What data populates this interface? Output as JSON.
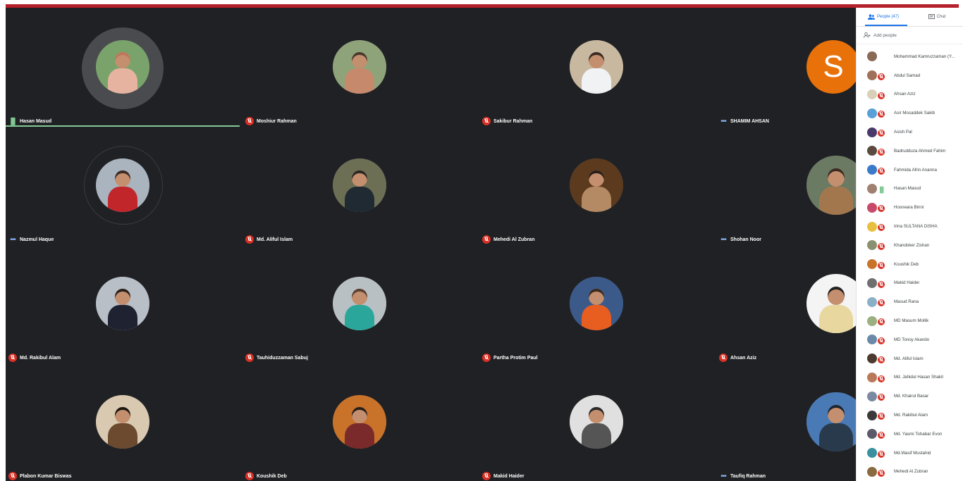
{
  "tiles": [
    {
      "name": "Hasan Masud",
      "status": "speaking",
      "photo": [
        "#7aa36b",
        "#c0765a",
        "#e6b3a0"
      ],
      "ring": "big"
    },
    {
      "name": "Moshiur Rahman",
      "status": "muted",
      "photo": [
        "#8fa37a",
        "#4a3a2e",
        "#c7896b"
      ]
    },
    {
      "name": "Sakibur Rahman",
      "status": "muted",
      "photo": [
        "#c8b8a0",
        "#3b2b24",
        "#f0f2f4"
      ]
    },
    {
      "name": "SHAMIM AHSAN",
      "status": "dots",
      "letter": "S"
    },
    {
      "name": "Nazmul Haque",
      "status": "dots",
      "photo": [
        "#a9b4bf",
        "#3b2b24",
        "#c1262b"
      ],
      "ring": "thin"
    },
    {
      "name": "Md. Aliful Islam",
      "status": "muted",
      "photo": [
        "#6d6f55",
        "#2d2622",
        "#1f2a33"
      ]
    },
    {
      "name": "Mehedi Al Zubran",
      "status": "muted",
      "photo": [
        "#5b3a1e",
        "#2a1f18",
        "#b38a63"
      ]
    },
    {
      "name": "Shohan Noor",
      "status": "dots",
      "photo": [
        "#6b7a63",
        "#3a2a22",
        "#a3774e"
      ],
      "big": true
    },
    {
      "name": "Md. Rakibul Alam",
      "status": "muted",
      "photo": [
        "#b9bfc6",
        "#2a211c",
        "#1f2230"
      ]
    },
    {
      "name": "Tauhiduzzaman Sabuj",
      "status": "muted",
      "photo": [
        "#b9c0c4",
        "#5a4032",
        "#2aa79a"
      ]
    },
    {
      "name": "Partha Protim Paul",
      "status": "muted",
      "photo": [
        "#3b5a8a",
        "#3a2a22",
        "#e85d20"
      ]
    },
    {
      "name": "Ahsan Aziz",
      "status": "muted",
      "photo": [
        "#f4f4f4",
        "#222222",
        "#e8d8a0"
      ],
      "big": true
    },
    {
      "name": "Plabon Kumar Biswas",
      "status": "muted",
      "photo": [
        "#d8c9b0",
        "#1d1712",
        "#6b4a30"
      ]
    },
    {
      "name": "Koushik Deb",
      "status": "muted",
      "photo": [
        "#c8722a",
        "#2a1f18",
        "#7a2a2a"
      ]
    },
    {
      "name": "Makid Haider",
      "status": "muted",
      "photo": [
        "#e0e0e0",
        "#2a2a2a",
        "#555555"
      ]
    },
    {
      "name": "Taufiq Rahman",
      "status": "dots",
      "photo": [
        "#4a7ab5",
        "#1a2433",
        "#2a3a4d"
      ],
      "big": true
    }
  ],
  "panel": {
    "people_tab": "People (47)",
    "chat_tab": "Chat",
    "add_people": "Add people",
    "people": [
      {
        "name": "Mohammad Kamruzzaman (Y...",
        "status": "none",
        "color": "#8a6a55"
      },
      {
        "name": "Abdul Samad",
        "status": "muted",
        "color": "#a0705a"
      },
      {
        "name": "Ahsan Aziz",
        "status": "muted",
        "color": "#d8d0b8"
      },
      {
        "name": "Asir Mosaddek Sakib",
        "status": "muted",
        "color": "#5aa0d8"
      },
      {
        "name": "Asish Pal",
        "status": "muted",
        "color": "#4a3a6a"
      },
      {
        "name": "Badrudduza Ahmed Fahim",
        "status": "muted",
        "color": "#5a4a40"
      },
      {
        "name": "Fahmida Afrin Ananna",
        "status": "muted",
        "color": "#3a7ac8"
      },
      {
        "name": "Hasan Masud",
        "status": "speaking",
        "color": "#a08070"
      },
      {
        "name": "Hosneara Binni",
        "status": "muted",
        "color": "#c84a6a"
      },
      {
        "name": "Irina SULTANA DISHA",
        "status": "muted",
        "color": "#e8c040"
      },
      {
        "name": "Khandoker Zishan",
        "status": "muted",
        "color": "#8a9070"
      },
      {
        "name": "Koushik Deb",
        "status": "muted",
        "color": "#c8722a"
      },
      {
        "name": "Makid Haider",
        "status": "muted",
        "color": "#707070"
      },
      {
        "name": "Masud Rana",
        "status": "muted",
        "color": "#8ab0c8"
      },
      {
        "name": "MD Masum Mollik",
        "status": "muted",
        "color": "#9ab080"
      },
      {
        "name": "MD Tonoy Akando",
        "status": "muted",
        "color": "#6a8aa8"
      },
      {
        "name": "Md. Aliful Islam",
        "status": "muted",
        "color": "#4a3a30"
      },
      {
        "name": "Md. Jahidul Hasan Shakil",
        "status": "muted",
        "color": "#b87a5a"
      },
      {
        "name": "Md. Khairul Basar",
        "status": "muted",
        "color": "#7a8aa0"
      },
      {
        "name": "Md. Rakibul Alam",
        "status": "muted",
        "color": "#3a3a3a"
      },
      {
        "name": "Md. Yasmi Tohabar Evon",
        "status": "muted",
        "color": "#5a5a6a"
      },
      {
        "name": "Md.Wasif Mustahid",
        "status": "muted",
        "color": "#3a90a0"
      },
      {
        "name": "Mehedi Al Zubran",
        "status": "muted",
        "color": "#8a6a40"
      }
    ]
  },
  "colors": {
    "accent": "#1a73e8",
    "muted": "#d93025",
    "speaking": "#81c995",
    "topbar": "#b5202a",
    "grid_bg": "#202124"
  }
}
